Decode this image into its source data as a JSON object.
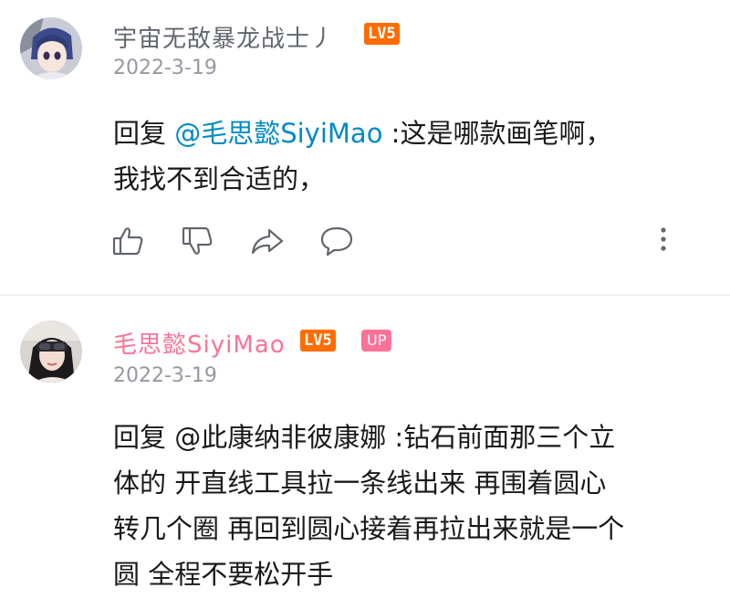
{
  "comments": [
    {
      "username": "宇宙无敌暴龙战士丿",
      "level": "LV5",
      "badge": "",
      "date": "2022-3-19",
      "reply_prefix": "回复 ",
      "mention": "@毛思懿SiyiMao",
      "text_line1": " :这是哪款画笔啊，",
      "text_line2": "我找不到合适的，",
      "actions": [
        "like-icon",
        "dislike-icon",
        "share-icon",
        "reply-icon",
        "more-icon"
      ]
    },
    {
      "username": "毛思懿SiyiMao",
      "level": "LV5",
      "badge": "UP",
      "date": "2022-3-19",
      "lines": [
        "回复 @此康纳非彼康娜 :钻石前面那三个立",
        "体的 开直线工具拉一条线出来 再围着圆心",
        "转几个圈 再回到圆心接着再拉出来就是一个",
        "圆 全程不要松开手"
      ]
    }
  ],
  "colors": {
    "username_gray": "#61666d",
    "username_pink": "#fb7299",
    "level_badge": "#ff6c00",
    "up_badge": "#fb7299",
    "mention_blue": "#008ac5",
    "date_gray": "#9499a0"
  }
}
